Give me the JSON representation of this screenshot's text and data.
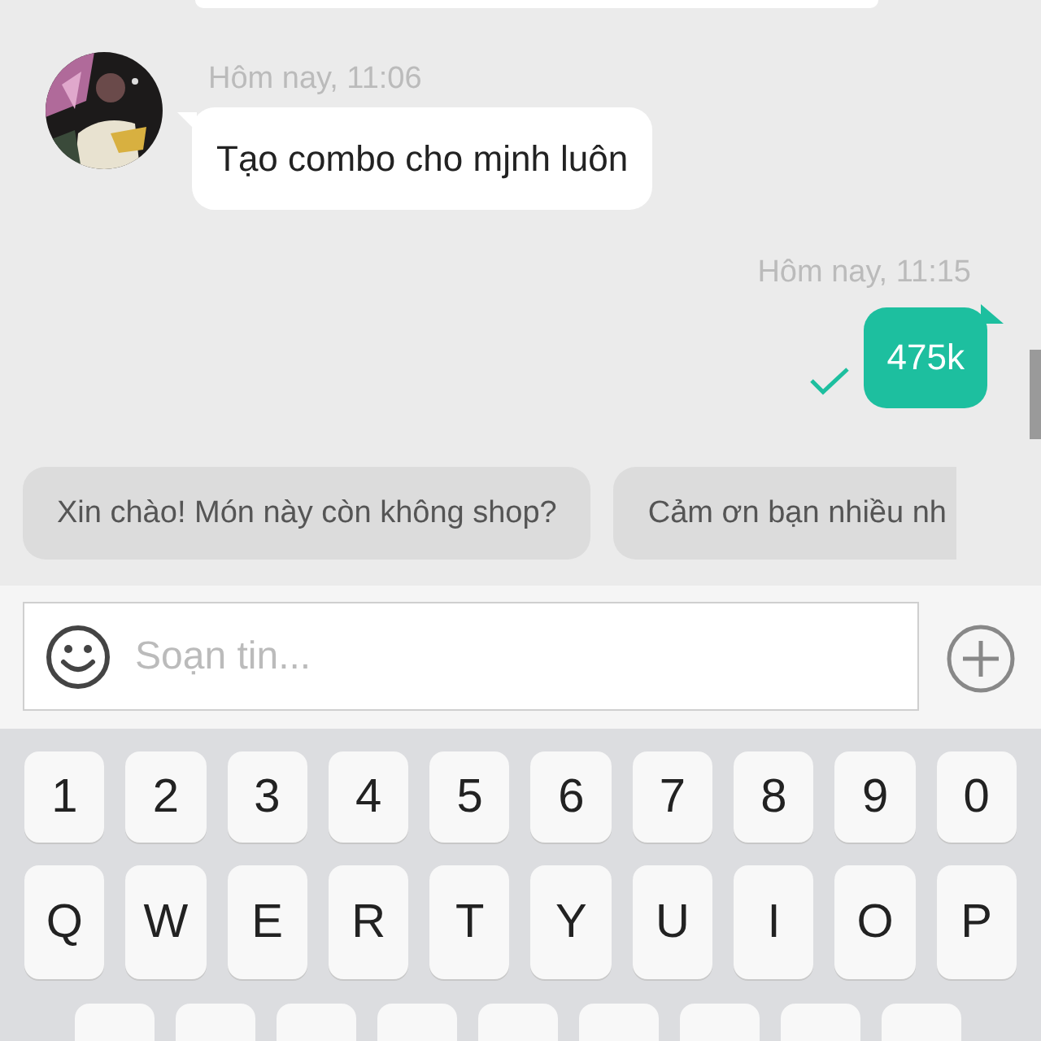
{
  "messages": [
    {
      "kind": "incoming",
      "time": "Hôm nay, 11:06",
      "text": "Tạo combo cho mjnh luôn"
    },
    {
      "kind": "outgoing",
      "time": "Hôm nay, 11:15",
      "text": "475k",
      "delivered": true
    }
  ],
  "quick_replies": [
    "Xin chào! Món này còn không shop?",
    "Cảm ơn bạn nhiều nh"
  ],
  "composer": {
    "placeholder": "Soạn tin..."
  },
  "keyboard": {
    "rows": [
      [
        "1",
        "2",
        "3",
        "4",
        "5",
        "6",
        "7",
        "8",
        "9",
        "0"
      ],
      [
        "Q",
        "W",
        "E",
        "R",
        "T",
        "Y",
        "U",
        "I",
        "O",
        "P"
      ]
    ]
  }
}
